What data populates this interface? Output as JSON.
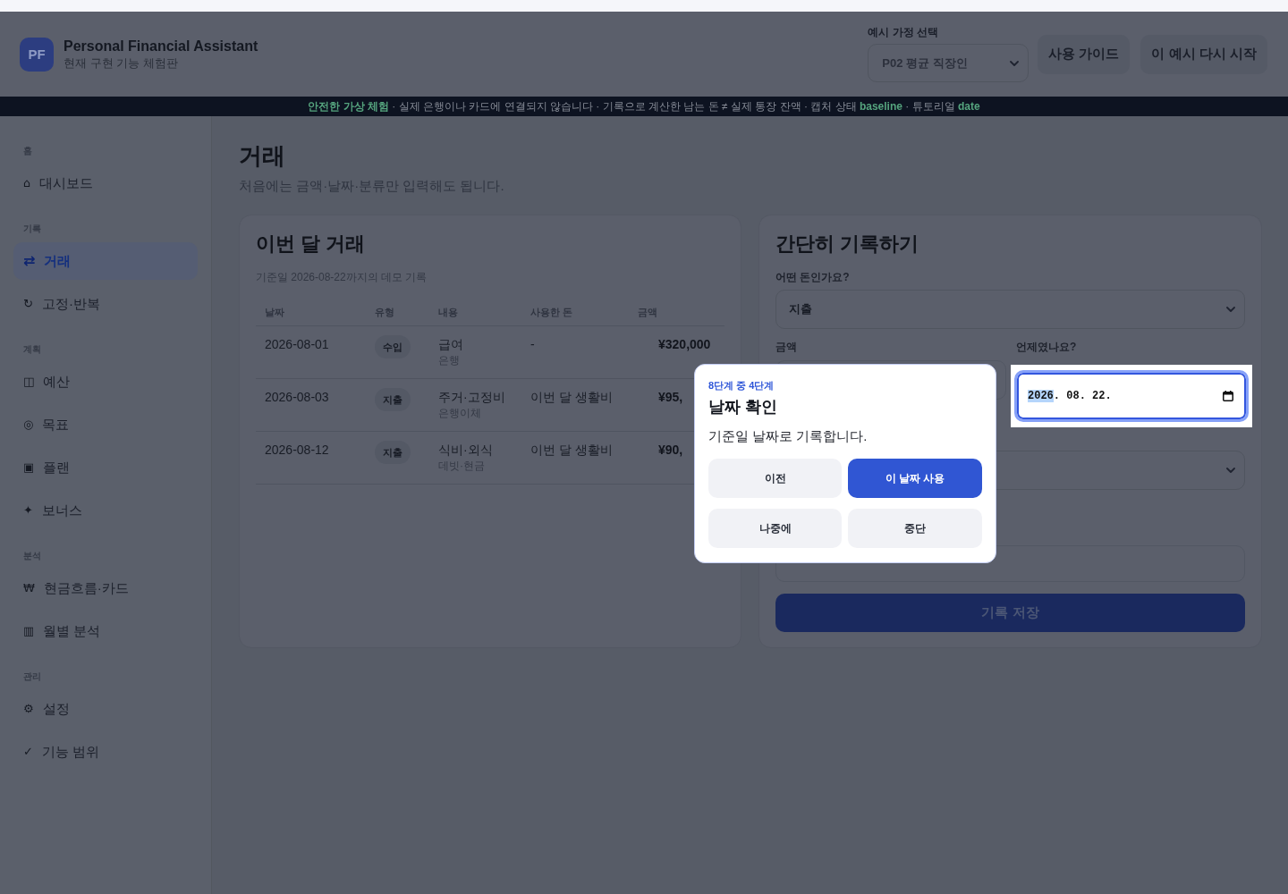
{
  "header": {
    "logo": "PF",
    "title": "Personal Financial Assistant",
    "subtitle": "현재 구현 기능 체험판",
    "scenario": {
      "label": "예시 가정 선택",
      "value": "P02 평균 직장인"
    },
    "buttons": [
      "사용 가이드",
      "이 예시 다시 시작"
    ]
  },
  "banner": "**안전한 가상 체험** · 실제 은행이나 카드에 연결되지 않습니다 · 기록으로 계산한 남는 돈 ≠ 실제 통장 잔액 · 캡처 상태 **baseline** · 튜토리얼 **date**",
  "sidebar": {
    "sections": [
      {
        "title": "홈",
        "items": [
          {
            "glyph": "⌂",
            "label": "대시보드",
            "selected": false
          }
        ]
      },
      {
        "title": "기록",
        "items": [
          {
            "glyph": "⇄",
            "label": "거래",
            "selected": true
          },
          {
            "glyph": "↻",
            "label": "고정·반복",
            "selected": false
          }
        ]
      },
      {
        "title": "계획",
        "items": [
          {
            "glyph": "◫",
            "label": "예산",
            "selected": false
          },
          {
            "glyph": "◎",
            "label": "목표",
            "selected": false
          },
          {
            "glyph": "▣",
            "label": "플랜",
            "selected": false
          },
          {
            "glyph": "✦",
            "label": "보너스",
            "selected": false
          }
        ]
      },
      {
        "title": "분석",
        "items": [
          {
            "glyph": "₩",
            "label": "현금흐름·카드",
            "selected": false
          },
          {
            "glyph": "▥",
            "label": "월별 분석",
            "selected": false
          }
        ]
      },
      {
        "title": "관리",
        "items": [
          {
            "glyph": "⚙",
            "label": "설정",
            "selected": false
          },
          {
            "glyph": "✓",
            "label": "기능 범위",
            "selected": false
          }
        ]
      }
    ]
  },
  "page": {
    "title": "거래",
    "subtitle": "처음에는 금액·날짜·분류만 입력해도 됩니다."
  },
  "transactions": {
    "title": "이번 달 거래",
    "caption": "기준일 2026-08-22까지의 데모 기록",
    "columns": [
      "날짜",
      "유형",
      "내용",
      "사용한 돈",
      "금액"
    ],
    "rows": [
      {
        "date": "2026-08-01",
        "type": "수입",
        "item": "급여",
        "account": "은행",
        "budget": "-",
        "amount": "¥320,000"
      },
      {
        "date": "2026-08-03",
        "type": "지출",
        "item": "주거·고정비",
        "account": "은행이체",
        "budget": "이번 달 생활비",
        "amount": "¥95,"
      },
      {
        "date": "2026-08-12",
        "type": "지출",
        "item": "식비·외식",
        "account": "데빗·현금",
        "budget": "이번 달 생활비",
        "amount": "¥90,"
      }
    ]
  },
  "quick_entry": {
    "title": "간단히 기록하기",
    "type_field": {
      "label": "어떤 돈인가요?",
      "value": "지출"
    },
    "amount_field": {
      "label": "금액"
    },
    "date_field": {
      "label": "언제였나요?",
      "focused": true,
      "highlighted": true,
      "segments": [
        {
          "text": "2026",
          "selected": true
        },
        {
          "text": ". 08",
          "selected": false
        },
        {
          "text": ". 22.",
          "selected": false
        }
      ]
    },
    "save_button": "기록 저장"
  },
  "tour": {
    "step": "8단계 중 4단계",
    "title": "날짜 확인",
    "body": "기준일 날짜로 기록합니다.",
    "buttons": [
      {
        "label": "이전",
        "kind": "secondary"
      },
      {
        "label": "이 날짜 사용",
        "kind": "primary"
      },
      {
        "label": "나중에",
        "kind": "secondary"
      },
      {
        "label": "중단",
        "kind": "secondary"
      }
    ]
  }
}
